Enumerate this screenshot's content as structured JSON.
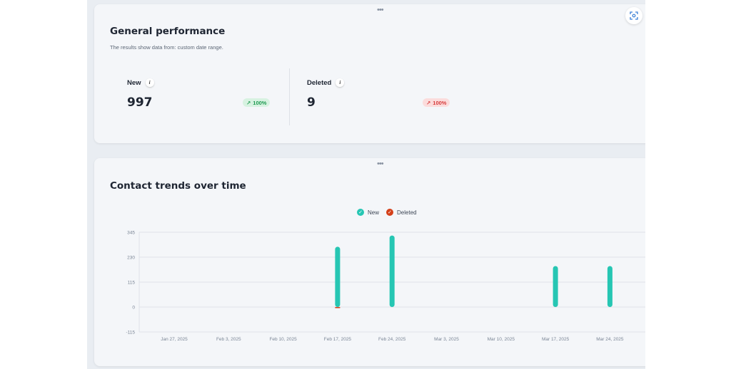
{
  "performance": {
    "title": "General performance",
    "subtitle": "The results show data from: custom date range.",
    "metrics": [
      {
        "label": "New",
        "value": "997",
        "change": "100%",
        "direction": "up",
        "badge_color": "#1f9a52"
      },
      {
        "label": "Deleted",
        "value": "9",
        "change": "100%",
        "direction": "up",
        "badge_color": "#d63c3c"
      }
    ],
    "info_icon": "i"
  },
  "trends": {
    "title": "Contact trends over time",
    "legend": [
      {
        "label": "New",
        "color": "#26c6b3"
      },
      {
        "label": "Deleted",
        "color": "#d4401a"
      }
    ]
  },
  "handle_glyph": "•••",
  "chart_data": {
    "type": "bar",
    "categories": [
      "Jan 27, 2025",
      "Feb 3, 2025",
      "Feb 10, 2025",
      "Feb 17, 2025",
      "Feb 24, 2025",
      "Mar 3, 2025",
      "Mar 10, 2025",
      "Mar 17, 2025",
      "Mar 24, 2025"
    ],
    "series": [
      {
        "name": "New",
        "values": [
          0,
          0,
          0,
          278,
          330,
          0,
          0,
          189,
          189
        ],
        "color": "#26c6b3"
      },
      {
        "name": "Deleted",
        "values": [
          0,
          0,
          0,
          5,
          0,
          0,
          0,
          0,
          0
        ],
        "color": "#d4401a"
      }
    ],
    "yticks": [
      345,
      230,
      115,
      0,
      -115
    ],
    "ylim": [
      -115,
      345
    ],
    "grid": true,
    "legend_position": "top"
  }
}
